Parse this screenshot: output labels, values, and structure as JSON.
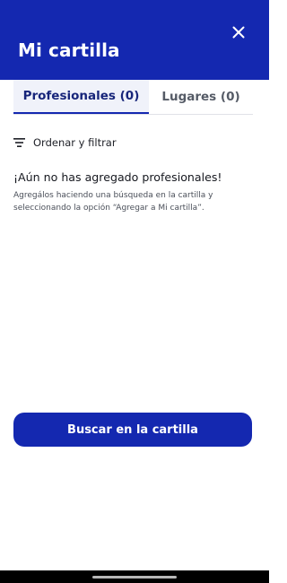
{
  "header": {
    "title": "Mi cartilla",
    "close_icon": "close-icon",
    "background_color": "#1428b0"
  },
  "tabs": [
    {
      "label": "Profesionales (0)",
      "active": true
    },
    {
      "label": "Lugares (0)",
      "active": false
    }
  ],
  "filter": {
    "label": "Ordenar y filtrar",
    "icon": "sort-filter-icon"
  },
  "empty_state": {
    "title": "¡Aún no has agregado profesionales!",
    "description": "Agregálos haciendo una búsqueda en la cartilla y seleccionando la opción “Agregar a Mi cartilla”."
  },
  "primary_button": {
    "label": "Buscar en la cartilla",
    "color": "#1428b0"
  }
}
